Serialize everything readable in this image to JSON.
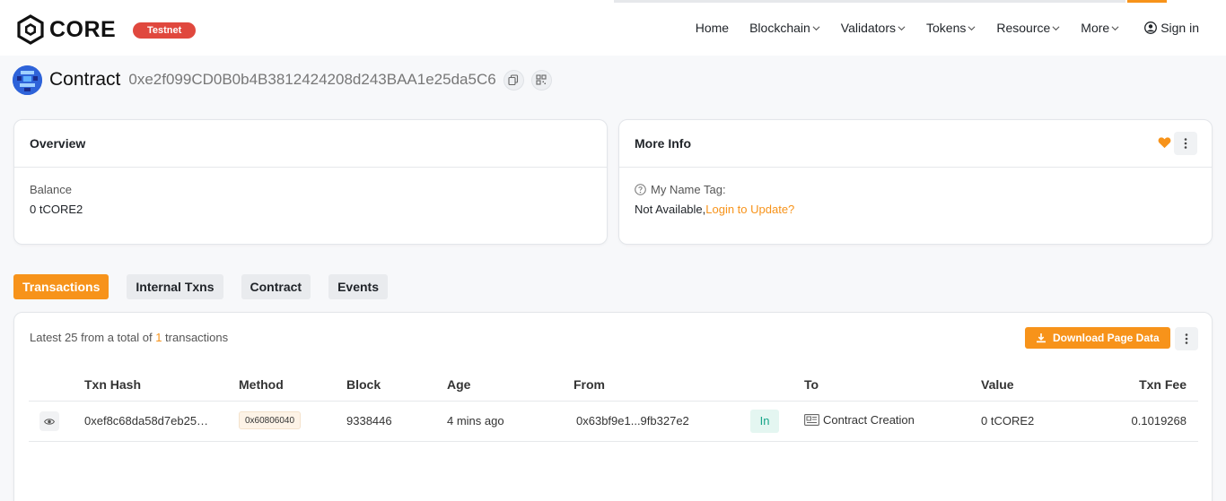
{
  "brand": {
    "name": "CORE",
    "network_badge": "Testnet",
    "accent_color": "#f7931a",
    "badge_color": "#e0483e"
  },
  "nav": {
    "items": [
      {
        "label": "Home",
        "dropdown": false
      },
      {
        "label": "Blockchain",
        "dropdown": true
      },
      {
        "label": "Validators",
        "dropdown": true
      },
      {
        "label": "Tokens",
        "dropdown": true
      },
      {
        "label": "Resource",
        "dropdown": true
      },
      {
        "label": "More",
        "dropdown": true
      }
    ],
    "sign_in": "Sign in"
  },
  "page": {
    "type_label": "Contract",
    "address": "0xe2f099CD0B0b4B3812424208d243BAA1e25da5C6"
  },
  "overview": {
    "title": "Overview",
    "balance_label": "Balance",
    "balance_value": "0 tCORE2"
  },
  "more_info": {
    "title": "More Info",
    "name_tag_label": "My Name Tag:",
    "name_tag_value": "Not Available,",
    "name_tag_link": "Login to Update?"
  },
  "tabs": [
    {
      "label": "Transactions",
      "active": true
    },
    {
      "label": "Internal Txns",
      "active": false
    },
    {
      "label": "Contract",
      "active": false
    },
    {
      "label": "Events",
      "active": false
    }
  ],
  "transactions": {
    "summary_prefix": "Latest 25 from a total of ",
    "summary_count": "1",
    "summary_suffix": " transactions",
    "download_label": "Download Page Data",
    "columns": [
      "Txn Hash",
      "Method",
      "Block",
      "Age",
      "From",
      "To",
      "Value",
      "Txn Fee"
    ],
    "rows": [
      {
        "txn_hash": "0xef8c68da58d7eb25…",
        "method": "0x60806040",
        "block": "9338446",
        "age": "4 mins ago",
        "from": "0x63bf9e1...9fb327e2",
        "direction": "In",
        "to": "Contract Creation",
        "value": "0 tCORE2",
        "txn_fee": "0.1019268"
      }
    ]
  }
}
